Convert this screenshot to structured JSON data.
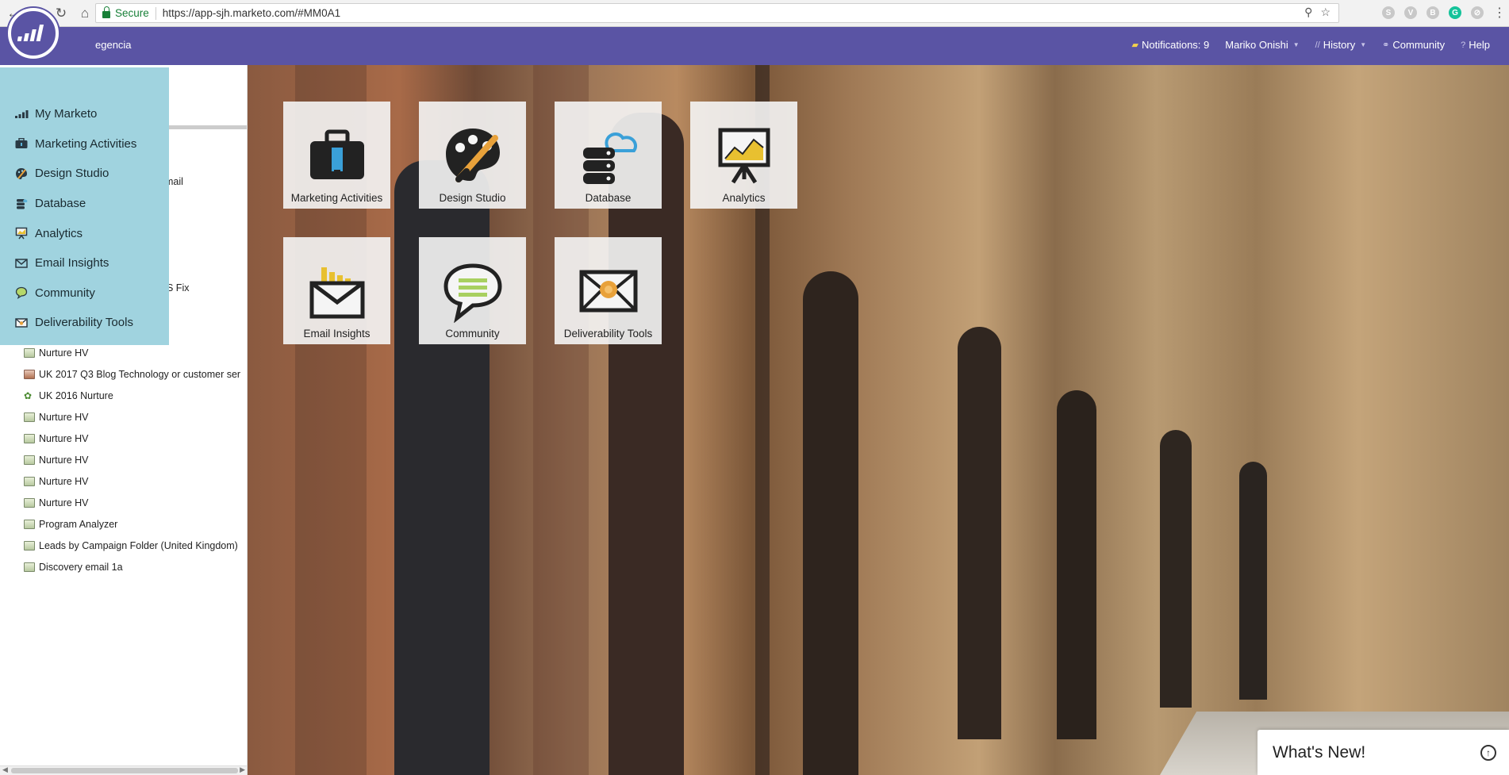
{
  "browser": {
    "back_icon": "←",
    "forward_icon": "→",
    "reload_icon": "↻",
    "home_icon": "⌂",
    "secure_label": "Secure",
    "url": "https://app-sjh.marketo.com/#MM0A1",
    "zoom_icon": "⚲",
    "star_icon": "☆",
    "menu_icon": "⋮",
    "extensions": [
      {
        "name": "skype-extension-icon",
        "glyph": "S"
      },
      {
        "name": "v-extension-icon",
        "glyph": "V"
      },
      {
        "name": "b-extension-icon",
        "glyph": "B"
      },
      {
        "name": "grammarly-extension-icon",
        "glyph": "G"
      },
      {
        "name": "o-extension-icon",
        "glyph": "⊘"
      }
    ]
  },
  "header": {
    "workspace": "egencia",
    "notifications": "Notifications: 9",
    "user": "Mariko Onishi",
    "history": "History",
    "community": "Community",
    "help": "Help",
    "colors": {
      "bar": "#5a54a4",
      "flyout": "#a0d3df"
    }
  },
  "flyout": {
    "items": [
      {
        "label": "My Marketo",
        "icon": "my-marketo-icon"
      },
      {
        "label": "Marketing Activities",
        "icon": "briefcase-icon"
      },
      {
        "label": "Design Studio",
        "icon": "palette-icon"
      },
      {
        "label": "Database",
        "icon": "database-icon"
      },
      {
        "label": "Analytics",
        "icon": "analytics-icon"
      },
      {
        "label": "Email Insights",
        "icon": "envelope-icon"
      },
      {
        "label": "Community",
        "icon": "speech-bubble-icon"
      },
      {
        "label": "Deliverability Tools",
        "icon": "deliverability-icon"
      }
    ]
  },
  "tree": {
    "partial_texts": [
      "mail",
      "S Fix"
    ],
    "items": [
      {
        "label": "Nurture HV",
        "icon": "program-icon"
      },
      {
        "label": "UK 2017 Q3 Blog Technology or customer ser",
        "icon": "program-red-icon"
      },
      {
        "label": "UK 2016 Nurture",
        "icon": "nurture-tree-icon"
      },
      {
        "label": "Nurture HV",
        "icon": "program-icon"
      },
      {
        "label": "Nurture HV",
        "icon": "program-icon"
      },
      {
        "label": "Nurture HV",
        "icon": "program-icon"
      },
      {
        "label": "Nurture HV",
        "icon": "program-icon"
      },
      {
        "label": "Nurture HV",
        "icon": "program-icon"
      },
      {
        "label": "Program Analyzer",
        "icon": "analyzer-icon"
      },
      {
        "label": "Leads by Campaign Folder (United Kingdom)",
        "icon": "report-icon"
      },
      {
        "label": "Discovery email 1a",
        "icon": "email-icon"
      }
    ]
  },
  "tiles": [
    {
      "label": "Marketing Activities",
      "icon": "briefcase-icon"
    },
    {
      "label": "Design Studio",
      "icon": "palette-icon"
    },
    {
      "label": "Database",
      "icon": "database-cloud-icon"
    },
    {
      "label": "Analytics",
      "icon": "analytics-board-icon"
    },
    {
      "label": "Email Insights",
      "icon": "email-insights-icon"
    },
    {
      "label": "Community",
      "icon": "speech-bubble-icon"
    },
    {
      "label": "Deliverability Tools",
      "icon": "deliverability-envelope-icon"
    }
  ],
  "whats_new": {
    "label": "What's New!",
    "icon": "arrow-up-circle-icon"
  }
}
